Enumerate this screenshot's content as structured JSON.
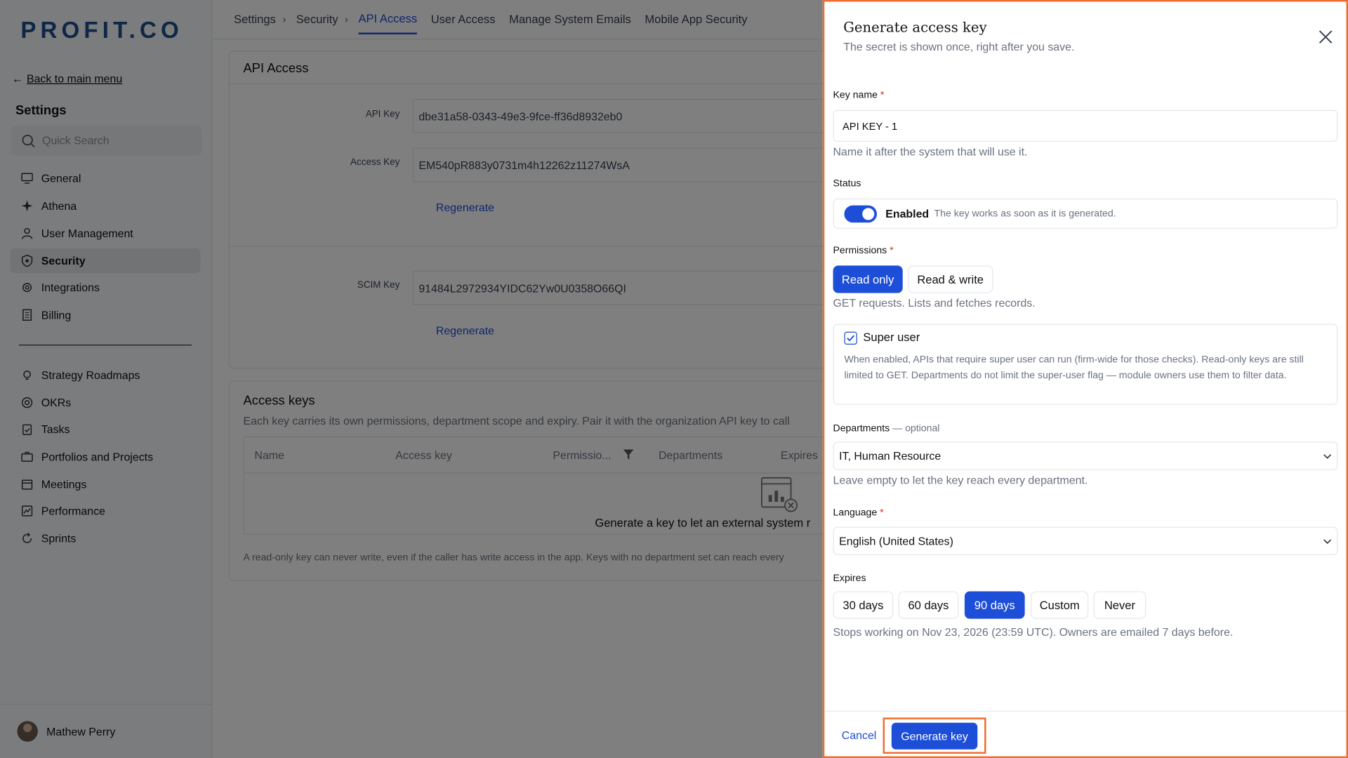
{
  "sidebar": {
    "logo": "PROFIT.CO",
    "back_label": "Back to main menu",
    "settings_title": "Settings",
    "search_placeholder": "Quick Search",
    "items": [
      {
        "label": "General",
        "icon": "monitor-icon"
      },
      {
        "label": "Athena",
        "icon": "sparkle-icon"
      },
      {
        "label": "User Management",
        "icon": "user-icon"
      },
      {
        "label": "Security",
        "icon": "shield-icon",
        "active": true
      },
      {
        "label": "Integrations",
        "icon": "gear-icon"
      },
      {
        "label": "Billing",
        "icon": "receipt-icon"
      },
      {
        "label": "Strategy Roadmaps",
        "icon": "bulb-icon"
      },
      {
        "label": "OKRs",
        "icon": "target-icon"
      },
      {
        "label": "Tasks",
        "icon": "clipboard-icon"
      },
      {
        "label": "Portfolios and Projects",
        "icon": "briefcase-icon"
      },
      {
        "label": "Meetings",
        "icon": "calendar-icon"
      },
      {
        "label": "Performance",
        "icon": "chart-icon"
      },
      {
        "label": "Sprints",
        "icon": "cycle-icon"
      }
    ],
    "user_name": "Mathew Perry"
  },
  "topnav": {
    "breadcrumbs": [
      "Settings",
      "Security"
    ],
    "tabs": [
      "API Access",
      "User Access",
      "Manage System Emails",
      "Mobile App Security"
    ],
    "active_tab": "API Access"
  },
  "api_access": {
    "title": "API Access",
    "api_key_label": "API Key",
    "api_key_value": "dbe31a58-0343-49e3-9fce-ff36d8932eb0",
    "access_key_label": "Access Key",
    "access_key_value": "EM540pR883y0731m4h12262z11274WsA",
    "regenerate": "Regenerate",
    "scim_key_label": "SCIM Key",
    "scim_key_value": "91484L2972934YIDC62Yw0U0358O66QI"
  },
  "access_keys": {
    "title": "Access keys",
    "description": "Each key carries its own permissions, department scope and expiry. Pair it with the organization API key to call",
    "columns": [
      "Name",
      "Access key",
      "Permissio...",
      "Departments",
      "Expires"
    ],
    "empty_text": "Generate a key to let an external system r",
    "footnote": "A read-only key can never write, even if the caller has write access in the app. Keys with no department set can reach every"
  },
  "panel": {
    "title": "Generate access key",
    "subtitle": "The secret is shown once, right after you save.",
    "key_name_label": "Key name",
    "key_name_value": "API KEY - 1",
    "key_name_hint": "Name it after the system that will use it.",
    "status_label": "Status",
    "status_value": "Enabled",
    "status_hint": "The key works as soon as it is generated.",
    "permissions_label": "Permissions",
    "permissions_options": [
      "Read only",
      "Read & write"
    ],
    "permissions_selected": "Read only",
    "permissions_hint": "GET requests. Lists and fetches records.",
    "superuser_label": "Super user",
    "superuser_checked": true,
    "superuser_desc": "When enabled, APIs that require super user can run (firm-wide for those checks). Read-only keys are still limited to GET. Departments do not limit the super-user flag — module owners use them to filter data.",
    "departments_label": "Departments",
    "departments_optional": "— optional",
    "departments_value": "IT, Human Resource",
    "departments_hint": "Leave empty to let the key reach every department.",
    "language_label": "Language",
    "language_value": "English (United States)",
    "expires_label": "Expires",
    "expires_options": [
      "30 days",
      "60 days",
      "90 days",
      "Custom",
      "Never"
    ],
    "expires_selected": "90 days",
    "expires_hint": "Stops working on Nov 23, 2026 (23:59 UTC). Owners are emailed 7 days before.",
    "cancel_label": "Cancel",
    "generate_label": "Generate key",
    "accent_color": "#1d4ed8",
    "highlight_color": "#ef6c2f"
  }
}
